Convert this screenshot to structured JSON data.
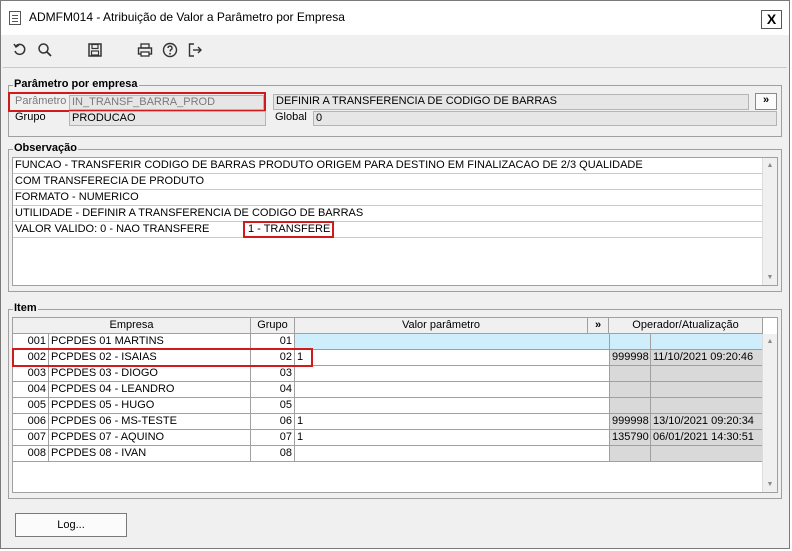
{
  "window": {
    "title": "ADMFM014 - Atribuição de Valor a Parâmetro por Empresa",
    "close_label": "X"
  },
  "toolbar": {
    "icons": [
      "undo-icon",
      "search-icon",
      "save-icon",
      "print-icon",
      "help-icon",
      "exit-icon"
    ]
  },
  "parametro": {
    "section_title": "Parâmetro por empresa",
    "parametro_label": "Parâmetro",
    "parametro_value": "IN_TRANSF_BARRA_PROD",
    "descricao_value": "DEFINIR A TRANSFERENCIA DE CODIGO DE BARRAS",
    "expand_label": "»",
    "grupo_label": "Grupo",
    "grupo_value": "PRODUCAO",
    "global_label": "Global",
    "global_value": "0"
  },
  "observacao": {
    "section_title": "Observação",
    "lines": [
      "FUNCAO - TRANSFERIR CODIGO DE BARRAS PRODUTO ORIGEM PARA DESTINO EM FINALIZACAO DE 2/3 QUALIDADE",
      "COM TRANSFERECIA DE PRODUTO",
      "FORMATO - NUMERICO",
      "UTILIDADE - DEFINIR A TRANSFERENCIA DE CODIGO DE BARRAS",
      "VALOR VALIDO: 0 - NAO TRANSFERE"
    ],
    "highlight_text": "1 - TRANSFERE"
  },
  "item": {
    "section_title": "Item",
    "columns": {
      "empresa": "Empresa",
      "grupo": "Grupo",
      "valor": "Valor parâmetro",
      "expand": "»",
      "operador": "Operador/Atualização"
    },
    "rows": [
      {
        "code": "001",
        "name": "PCPDES 01 MARTINS",
        "grupo": "01",
        "valor": "",
        "operador": "",
        "data": ""
      },
      {
        "code": "002",
        "name": "PCPDES 02 - ISAIAS",
        "grupo": "02",
        "valor": "1",
        "operador": "999998",
        "data": "11/10/2021 09:20:46"
      },
      {
        "code": "003",
        "name": "PCPDES 03 - DIOGO",
        "grupo": "03",
        "valor": "",
        "operador": "",
        "data": ""
      },
      {
        "code": "004",
        "name": "PCPDES 04 - LEANDRO",
        "grupo": "04",
        "valor": "",
        "operador": "",
        "data": ""
      },
      {
        "code": "005",
        "name": "PCPDES 05 - HUGO",
        "grupo": "05",
        "valor": "",
        "operador": "",
        "data": ""
      },
      {
        "code": "006",
        "name": "PCPDES 06 - MS-TESTE",
        "grupo": "06",
        "valor": "1",
        "operador": "999998",
        "data": "13/10/2021 09:20:34"
      },
      {
        "code": "007",
        "name": "PCPDES 07 - AQUINO",
        "grupo": "07",
        "valor": "1",
        "operador": "135790",
        "data": "06/01/2021 14:30:51"
      },
      {
        "code": "008",
        "name": "PCPDES 08 - IVAN",
        "grupo": "08",
        "valor": "",
        "operador": "",
        "data": ""
      }
    ]
  },
  "footer": {
    "log_label": "Log..."
  }
}
